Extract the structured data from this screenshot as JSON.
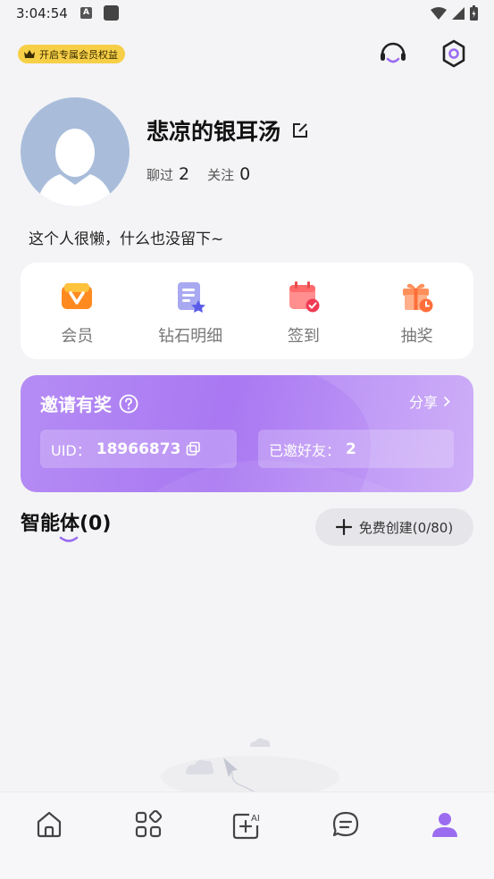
{
  "status_bar": {
    "time": "3:04:54",
    "a_icon_letter": "A"
  },
  "top": {
    "vip_badge_label": "开启专属会员权益"
  },
  "profile": {
    "nickname": "悲凉的银耳汤",
    "chatted_label": "聊过",
    "chatted_value": "2",
    "following_label": "关注",
    "following_value": "0",
    "bio": "这个人很懒，什么也没留下~"
  },
  "features": [
    {
      "label": "会员",
      "icon": "vip-icon"
    },
    {
      "label": "钻石明细",
      "icon": "diamond-detail-icon"
    },
    {
      "label": "签到",
      "icon": "checkin-calendar-icon"
    },
    {
      "label": "抽奖",
      "icon": "lottery-gift-icon"
    }
  ],
  "invite": {
    "title": "邀请有奖",
    "share_label": "分享",
    "uid_label": "UID：",
    "uid_value": "18966873",
    "invited_label": "已邀好友：",
    "invited_value": "2"
  },
  "agents": {
    "title": "智能体(0)",
    "create_label": "免费创建(0/80)"
  },
  "bottom_nav": [
    {
      "name": "home",
      "icon": "home-icon"
    },
    {
      "name": "discover",
      "icon": "apps-grid-icon"
    },
    {
      "name": "create-ai",
      "icon": "add-ai-icon"
    },
    {
      "name": "messages",
      "icon": "chat-icon"
    },
    {
      "name": "profile",
      "icon": "person-icon",
      "active": true
    }
  ],
  "colors": {
    "accent": "#9b6cf0",
    "vip_gold": "#f7cf47",
    "invite_bg": "#a978f2"
  }
}
